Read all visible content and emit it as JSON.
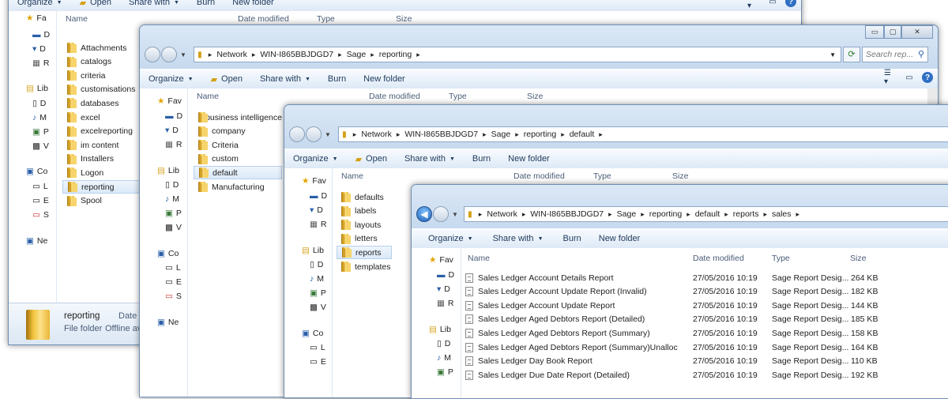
{
  "toolbar": {
    "organize": "Organize",
    "open": "Open",
    "share_with": "Share with",
    "burn": "Burn",
    "new_folder": "New folder"
  },
  "columns": {
    "name": "Name",
    "date_modified": "Date modified",
    "type": "Type",
    "size": "Size"
  },
  "nav": {
    "favorites": "Fav",
    "libraries": "Lib",
    "computer": "Co",
    "network": "Ne",
    "w1": {
      "favorites": "Fa",
      "libraries": "Lib",
      "computer": "Co",
      "network": "Ne"
    },
    "d": "D",
    "m": "M",
    "p": "P",
    "v": "V",
    "r": "R",
    "l": "L",
    "e": "E",
    "s": "S"
  },
  "window1": {
    "folders": [
      "Attachments",
      "catalogs",
      "criteria",
      "customisations",
      "databases",
      "excel",
      "excelreporting",
      "im content",
      "Installers",
      "Logon",
      "reporting",
      "Spool"
    ],
    "selected_index": 10,
    "details": {
      "name": "reporting",
      "type": "File folder",
      "date_label": "Date re",
      "offline": "Offline ava"
    }
  },
  "window2": {
    "breadcrumb": [
      "Network",
      "WIN-I865BBJDGD7",
      "Sage",
      "reporting"
    ],
    "search_placeholder": "Search rep...",
    "folders": [
      "business intelligence",
      "company",
      "Criteria",
      "custom",
      "default",
      "Manufacturing"
    ],
    "selected_index": 4
  },
  "window3": {
    "breadcrumb": [
      "Network",
      "WIN-I865BBJDGD7",
      "Sage",
      "reporting",
      "default"
    ],
    "folders": [
      "defaults",
      "labels",
      "layouts",
      "letters",
      "reports",
      "templates"
    ],
    "selected_index": 4
  },
  "window4": {
    "breadcrumb": [
      "Network",
      "WIN-I865BBJDGD7",
      "Sage",
      "reporting",
      "default",
      "reports",
      "sales"
    ],
    "files": [
      {
        "name": "Sales Ledger Account Details Report",
        "date": "27/05/2016 10:19",
        "type": "Sage Report Desig...",
        "size": "264 KB"
      },
      {
        "name": "Sales Ledger Account Update Report (Invalid)",
        "date": "27/05/2016 10:19",
        "type": "Sage Report Desig...",
        "size": "182 KB"
      },
      {
        "name": "Sales Ledger Account Update Report",
        "date": "27/05/2016 10:19",
        "type": "Sage Report Desig...",
        "size": "144 KB"
      },
      {
        "name": "Sales Ledger Aged Debtors Report (Detailed)",
        "date": "27/05/2016 10:19",
        "type": "Sage Report Desig...",
        "size": "185 KB"
      },
      {
        "name": "Sales Ledger Aged Debtors Report (Summary)",
        "date": "27/05/2016 10:19",
        "type": "Sage Report Desig...",
        "size": "158 KB"
      },
      {
        "name": "Sales Ledger Aged Debtors Report (Summary)Unalloc",
        "date": "27/05/2016 10:19",
        "type": "Sage Report Desig...",
        "size": "164 KB"
      },
      {
        "name": "Sales Ledger Day Book Report",
        "date": "27/05/2016 10:19",
        "type": "Sage Report Desig...",
        "size": "110 KB"
      },
      {
        "name": "Sales Ledger Due Date Report (Detailed)",
        "date": "27/05/2016 10:19",
        "type": "Sage Report Desig...",
        "size": "192 KB"
      }
    ]
  }
}
